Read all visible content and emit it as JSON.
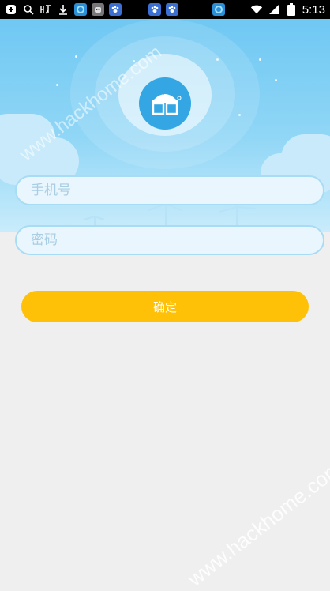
{
  "status_bar": {
    "time": "5:13",
    "left_icons": [
      "add-box-icon",
      "search-icon",
      "listen-icon",
      "download-icon",
      "app-icon",
      "robot-icon",
      "paw-icon",
      "paw-icon",
      "paw-icon"
    ],
    "right_icons": [
      "app-icon",
      "wifi-icon",
      "signal-icon",
      "battery-icon"
    ]
  },
  "login": {
    "phone_placeholder": "手机号",
    "password_placeholder": "密码",
    "confirm_label": "确定"
  },
  "watermark": {
    "text": "www.hackhome.com"
  },
  "colors": {
    "sky_top": "#6fc8f3",
    "logo_blue": "#33a6e3",
    "button_yellow": "#ffc107",
    "input_border": "#a8dcf5",
    "background": "#efefef"
  }
}
